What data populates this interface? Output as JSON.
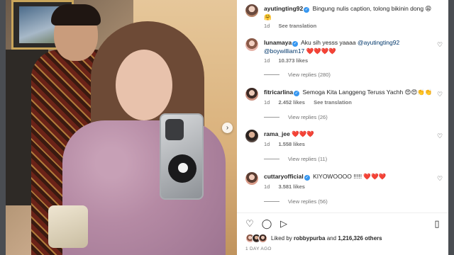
{
  "post": {
    "caption": {
      "username": "ayutingting92",
      "text": "Bingung nulis caption, tolong bikinin dong 😩🤗",
      "time": "1d",
      "translate": "See translation"
    },
    "comments": [
      {
        "username": "lunamaya",
        "verified": true,
        "text_plain": "Aku sih yesss yaaaa",
        "mention1": "@ayutingting92",
        "mention2": "@boywilliam17",
        "hearts": "❤️❤️❤️❤️",
        "time": "1d",
        "likes": "10.373 likes",
        "replies": "View replies (280)"
      },
      {
        "username": "fitricarlina",
        "verified": true,
        "text": "Semoga Kita Langgeng Teruss Yachh 😍😍👏👏",
        "time": "1d",
        "likes": "2.452 likes",
        "translate": "See translation",
        "replies": "View replies (26)"
      },
      {
        "username": "rama_jee",
        "verified": false,
        "text": "❤️❤️❤️",
        "time": "1d",
        "likes": "1.558 likes",
        "replies": "View replies (11)"
      },
      {
        "username": "cuttaryofficial",
        "verified": true,
        "text": "KIYOWOOOO !!!!! ❤️❤️❤️",
        "time": "1d",
        "likes": "3.581 likes",
        "replies": "View replies (56)"
      }
    ],
    "likes_summary": {
      "prefix": "Liked by",
      "user": "robbypurba",
      "connector": "and",
      "count": "1,216,326 others"
    },
    "date": "1 DAY AGO"
  },
  "icons": {
    "heart": "♡",
    "comment": "◯",
    "share": "▷",
    "save": "▯",
    "next": "›",
    "verified": "✓"
  },
  "colors": {
    "verified": "#3797f0",
    "mention": "#00376b",
    "muted": "#737373"
  }
}
